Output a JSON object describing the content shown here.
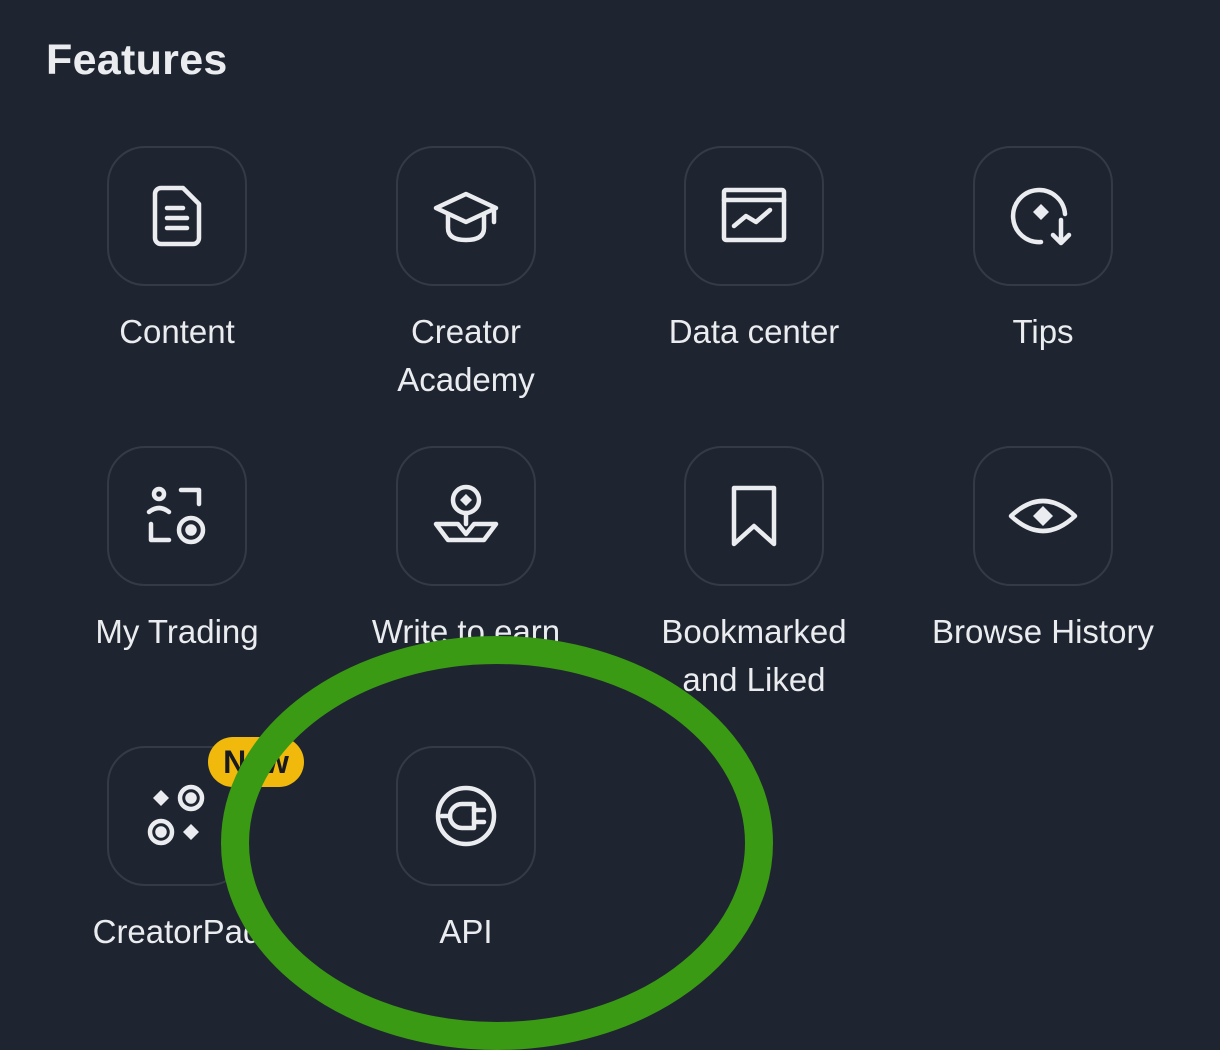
{
  "header": {
    "title": "Features"
  },
  "features": [
    {
      "label": "Content",
      "icon": "document-icon"
    },
    {
      "label": "Creator\nAcademy",
      "icon": "graduation-cap-icon"
    },
    {
      "label": "Data center",
      "icon": "chart-icon"
    },
    {
      "label": "Tips",
      "icon": "tips-icon"
    },
    {
      "label": "My Trading",
      "icon": "trading-icon"
    },
    {
      "label": "Write to earn",
      "icon": "write-to-earn-icon"
    },
    {
      "label": "Bookmarked\nand Liked",
      "icon": "bookmark-icon"
    },
    {
      "label": "Browse History",
      "icon": "eye-icon"
    },
    {
      "label": "CreatorPad",
      "icon": "creatorpad-icon",
      "badge": "New"
    },
    {
      "label": "API",
      "icon": "plug-icon"
    }
  ],
  "colors": {
    "background": "#1f2530",
    "text": "#eaecef",
    "icon_border": "#343b47",
    "badge": "#f0b90b",
    "annotation_circle": "#3a9a14"
  }
}
